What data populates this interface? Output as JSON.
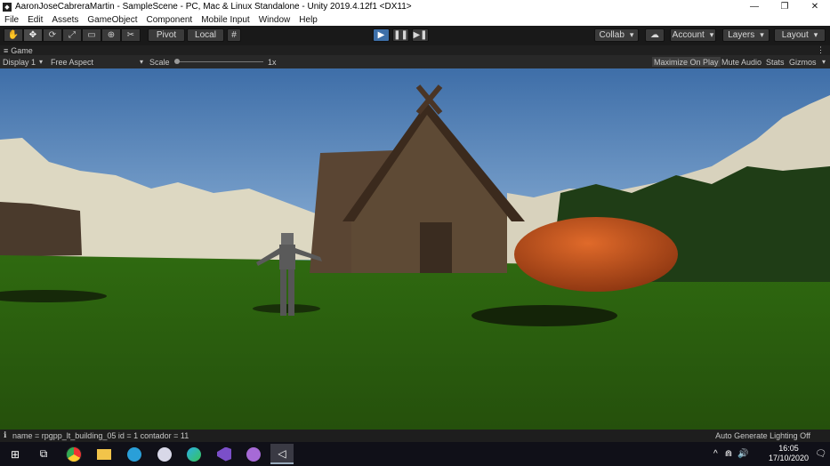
{
  "window": {
    "title": "AaronJoseCabreraMartin - SampleScene - PC, Mac & Linux Standalone - Unity 2019.4.12f1 <DX11>",
    "app_icon": "unity-logo-icon",
    "controls": [
      "—",
      "❐",
      "✕"
    ]
  },
  "menu": [
    "File",
    "Edit",
    "Assets",
    "GameObject",
    "Component",
    "Mobile Input",
    "Window",
    "Help"
  ],
  "toolbar": {
    "tools": [
      "✋",
      "✥",
      "⟳",
      "⤢",
      "▭",
      "⊕",
      "✂"
    ],
    "pivot": "Pivot",
    "local": "Local",
    "grid_icon": "#",
    "play": "▶",
    "pause": "❚❚",
    "step": "▶❚",
    "collab": "Collab",
    "cloud": "☁",
    "account": "Account",
    "layers": "Layers",
    "layout": "Layout"
  },
  "game_tab": {
    "icon": "≡",
    "label": "Game",
    "menu_icon": "⋮"
  },
  "game_controls": {
    "display": "Display 1",
    "aspect": "Free Aspect",
    "scale_label": "Scale",
    "scale_value": "1x",
    "maximize": "Maximize On Play",
    "mute": "Mute Audio",
    "stats": "Stats",
    "gizmos": "Gizmos"
  },
  "status": {
    "icon": "ℹ",
    "message": "name = rpgpp_lt_building_05 id = 1 contador = 11",
    "lighting": "Auto Generate Lighting Off"
  },
  "taskbar": {
    "start": "⊞",
    "task_view": "⧉",
    "apps": [
      "chrome-icon",
      "file-explorer-icon",
      "telegram-icon",
      "app-icon",
      "edge-icon",
      "visual-studio-icon",
      "app-purple-icon",
      "unity-icon"
    ],
    "tray_icons": [
      "^",
      "⋒",
      "🔊"
    ],
    "time": "16:05",
    "date": "17/10/2020",
    "notification": "🗨"
  },
  "colors": {
    "sky_top": "#4a7ab0",
    "ground": "#2e6a12",
    "accent_play": "#3d6fa8",
    "capsule": "#c9571b"
  }
}
